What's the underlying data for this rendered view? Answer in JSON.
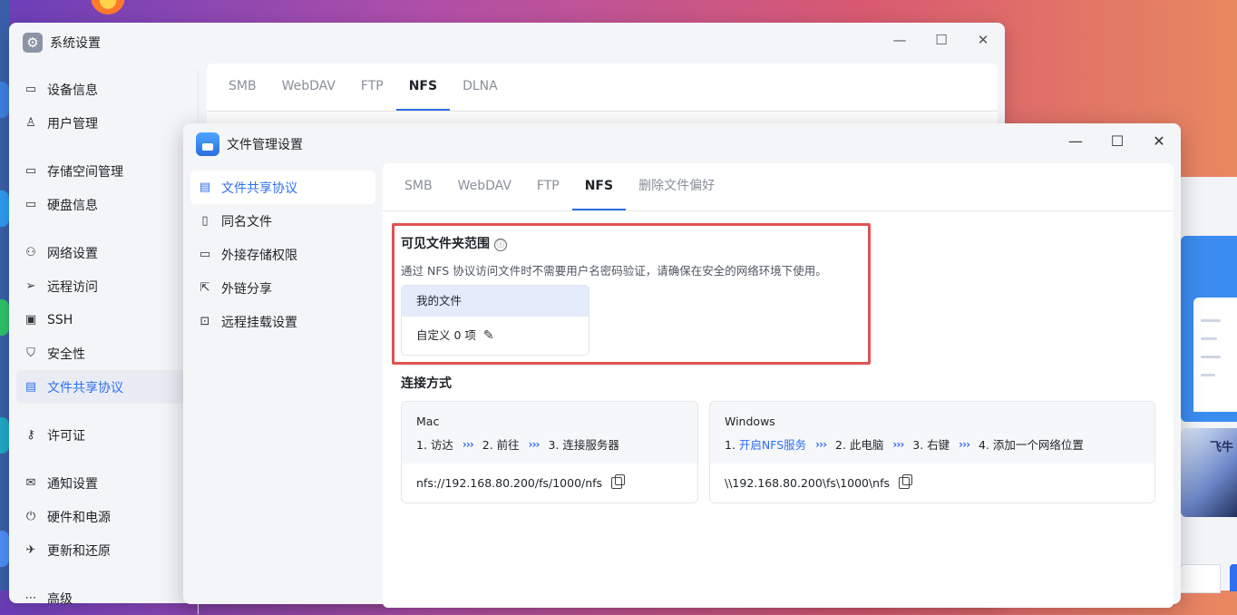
{
  "back_window": {
    "title": "系统设置",
    "controls": [
      "—",
      "☐",
      "✕"
    ],
    "nav": [
      {
        "label": "设备信息",
        "icon": "drive-icon"
      },
      {
        "label": "用户管理",
        "icon": "user-icon"
      },
      {
        "label": "存储空间管理",
        "icon": "drive-icon"
      },
      {
        "label": "硬盘信息",
        "icon": "disk-icon"
      },
      {
        "label": "网络设置",
        "icon": "network-icon"
      },
      {
        "label": "远程访问",
        "icon": "send-icon"
      },
      {
        "label": "SSH",
        "icon": "terminal-icon"
      },
      {
        "label": "安全性",
        "icon": "shield-icon"
      },
      {
        "label": "文件共享协议",
        "icon": "document-icon"
      },
      {
        "label": "许可证",
        "icon": "key-icon"
      },
      {
        "label": "通知设置",
        "icon": "mail-icon"
      },
      {
        "label": "硬件和电源",
        "icon": "power-icon"
      },
      {
        "label": "更新和还原",
        "icon": "rocket-icon"
      },
      {
        "label": "高级",
        "icon": "more-icon"
      }
    ],
    "tabs": [
      "SMB",
      "WebDAV",
      "FTP",
      "NFS",
      "DLNA"
    ],
    "active_tab": "NFS"
  },
  "front_window": {
    "title": "文件管理设置",
    "controls": [
      "—",
      "☐",
      "✕"
    ],
    "nav": [
      {
        "label": "文件共享协议",
        "icon": "document-icon"
      },
      {
        "label": "同名文件",
        "icon": "file-icon"
      },
      {
        "label": "外接存储权限",
        "icon": "drive-icon"
      },
      {
        "label": "外链分享",
        "icon": "share-icon"
      },
      {
        "label": "远程挂载设置",
        "icon": "mount-icon"
      }
    ],
    "tabs": [
      "SMB",
      "WebDAV",
      "FTP",
      "NFS",
      "删除文件偏好"
    ],
    "active_tab": "NFS",
    "visible_folder": {
      "title": "可见文件夹范围",
      "info_icon": "ⓘ",
      "desc": "通过 NFS 协议访问文件时不需要用户名密码验证，请确保在安全的网络环境下使用。",
      "card_head": "我的文件",
      "card_body": "自定义 0 项"
    },
    "connection": {
      "title": "连接方式",
      "mac": {
        "os": "Mac",
        "steps": [
          "1. 访达",
          "2. 前往",
          "3. 连接服务器"
        ],
        "path": "nfs://192.168.80.200/fs/1000/nfs"
      },
      "windows": {
        "os": "Windows",
        "step1_prefix": "1. ",
        "step1_link": "开启NFS服务",
        "steps": [
          "2. 此电脑",
          "3. 右键",
          "4. 添加一个网络位置"
        ],
        "path": "\\\\192.168.80.200\\fs\\1000\\nfs"
      },
      "arrow_glyph": "›››"
    }
  },
  "desktop": {
    "right_card_text": "飞牛"
  }
}
